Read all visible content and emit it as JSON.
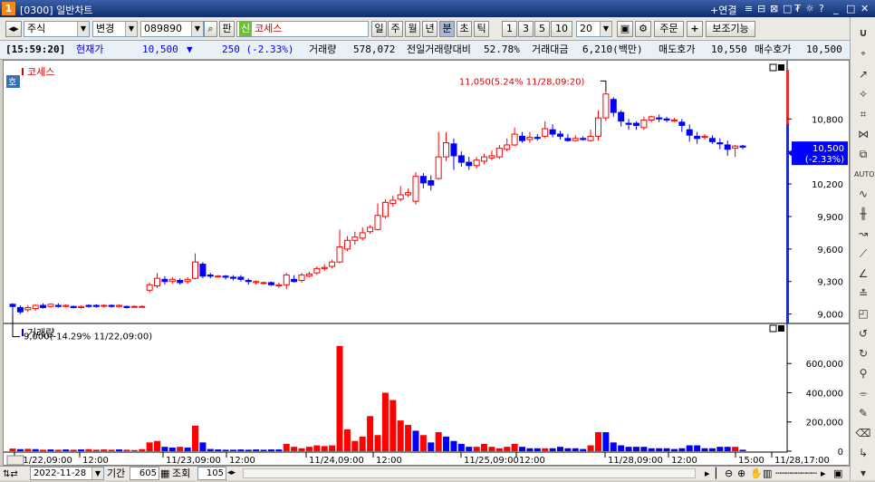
{
  "window": {
    "number": "1",
    "title": "[0300] 일반차트",
    "controls": [
      "+연결",
      "≡",
      "⊟",
      "⊠",
      "□",
      "₮",
      "☼",
      "?",
      "_",
      "□",
      "✕"
    ]
  },
  "toolbar": {
    "market_select": "주식",
    "change_select": "변경",
    "code_input": "089890",
    "pan_label": "판",
    "new_badge": "신",
    "stock_name": "코세스",
    "period_buttons": [
      "일",
      "주",
      "월",
      "년",
      "분",
      "초",
      "틱"
    ],
    "period_selected": "분",
    "interval_buttons": [
      "1",
      "3",
      "5",
      "10"
    ],
    "interval_value": "20",
    "order_button": "주문",
    "plus_label": "+",
    "aux_button": "보조기능"
  },
  "info": {
    "time": "[15:59:20]",
    "price_label": "현재가",
    "price": "10,500",
    "arrow": "▼",
    "change": "250 (-2.33%)",
    "volume_label": "거래량",
    "volume": "578,072",
    "prev_volume_label": "전일거래량대비",
    "prev_volume_ratio": "52.78%",
    "amount_label": "거래대금",
    "amount": "6,210(백만)",
    "ask_label": "매도호가",
    "ask": "10,550",
    "bid_label": "매수호가",
    "bid": "10,500"
  },
  "chart_data": [
    {
      "type": "candlestick",
      "title": "코세스",
      "side_badge": "호",
      "y_ticks": [
        "10,800",
        "10,500",
        "10,200",
        "9,900",
        "9,600",
        "9,300",
        "9,000"
      ],
      "ylim": [
        8930,
        11170
      ],
      "current_price_label": "10,500",
      "current_change_label": "(-2.33%)",
      "high_annotation": "11,050(5.24% 11/28,09:20)",
      "low_annotation": "9,000(-14.29% 11/22,09:00)",
      "candles": [
        [
          9090,
          9070,
          9100,
          9000
        ],
        [
          9060,
          9020,
          9080,
          9000
        ],
        [
          9040,
          9060,
          9080,
          9020
        ],
        [
          9050,
          9080,
          9090,
          9030
        ],
        [
          9080,
          9060,
          9100,
          9050
        ],
        [
          9070,
          9090,
          9100,
          9060
        ],
        [
          9080,
          9070,
          9100,
          9060
        ],
        [
          9070,
          9080,
          9090,
          9060
        ],
        [
          9070,
          9060,
          9080,
          9050
        ],
        [
          9060,
          9070,
          9080,
          9050
        ],
        [
          9080,
          9070,
          9090,
          9060
        ],
        [
          9080,
          9070,
          9090,
          9060
        ],
        [
          9080,
          9080,
          9090,
          9060
        ],
        [
          9080,
          9070,
          9090,
          9060
        ],
        [
          9070,
          9080,
          9090,
          9060
        ],
        [
          9070,
          9060,
          9080,
          9050
        ],
        [
          9070,
          9070,
          9080,
          9060
        ],
        [
          9070,
          9070,
          9080,
          9060
        ],
        [
          9220,
          9270,
          9290,
          9200
        ],
        [
          9260,
          9330,
          9380,
          9240
        ],
        [
          9320,
          9300,
          9350,
          9270
        ],
        [
          9300,
          9320,
          9340,
          9280
        ],
        [
          9310,
          9290,
          9330,
          9270
        ],
        [
          9300,
          9320,
          9340,
          9280
        ],
        [
          9330,
          9480,
          9560,
          9320
        ],
        [
          9460,
          9350,
          9480,
          9330
        ],
        [
          9360,
          9350,
          9380,
          9330
        ],
        [
          9350,
          9350,
          9360,
          9340
        ],
        [
          9350,
          9340,
          9360,
          9320
        ],
        [
          9340,
          9330,
          9360,
          9310
        ],
        [
          9340,
          9320,
          9360,
          9300
        ],
        [
          9310,
          9300,
          9330,
          9270
        ],
        [
          9290,
          9300,
          9310,
          9270
        ],
        [
          9290,
          9290,
          9300,
          9270
        ],
        [
          9290,
          9270,
          9300,
          9260
        ],
        [
          9260,
          9270,
          9290,
          9240
        ],
        [
          9270,
          9360,
          9380,
          9230
        ],
        [
          9320,
          9300,
          9360,
          9290
        ],
        [
          9310,
          9360,
          9380,
          9290
        ],
        [
          9350,
          9370,
          9390,
          9340
        ],
        [
          9380,
          9420,
          9440,
          9360
        ],
        [
          9420,
          9430,
          9460,
          9400
        ],
        [
          9440,
          9480,
          9500,
          9420
        ],
        [
          9480,
          9620,
          9780,
          9470
        ],
        [
          9600,
          9680,
          9720,
          9580
        ],
        [
          9680,
          9710,
          9760,
          9640
        ],
        [
          9700,
          9750,
          9800,
          9680
        ],
        [
          9760,
          9800,
          9820,
          9740
        ],
        [
          9780,
          9910,
          10020,
          9770
        ],
        [
          9900,
          10030,
          10060,
          9880
        ],
        [
          10020,
          10050,
          10090,
          9990
        ],
        [
          10060,
          10100,
          10180,
          10040
        ],
        [
          10100,
          10120,
          10160,
          10080
        ],
        [
          10040,
          10270,
          10310,
          10010
        ],
        [
          10270,
          10210,
          10300,
          10160
        ],
        [
          10230,
          10190,
          10280,
          10140
        ],
        [
          10250,
          10450,
          10680,
          10240
        ],
        [
          10450,
          10580,
          10680,
          10410
        ],
        [
          10570,
          10460,
          10620,
          10330
        ],
        [
          10460,
          10400,
          10500,
          10360
        ],
        [
          10400,
          10370,
          10450,
          10330
        ],
        [
          10370,
          10420,
          10450,
          10340
        ],
        [
          10410,
          10450,
          10480,
          10380
        ],
        [
          10440,
          10460,
          10510,
          10420
        ],
        [
          10450,
          10530,
          10560,
          10430
        ],
        [
          10520,
          10560,
          10620,
          10500
        ],
        [
          10560,
          10660,
          10720,
          10550
        ],
        [
          10640,
          10600,
          10680,
          10580
        ],
        [
          10610,
          10630,
          10680,
          10580
        ],
        [
          10630,
          10620,
          10660,
          10600
        ],
        [
          10640,
          10710,
          10780,
          10620
        ],
        [
          10700,
          10660,
          10750,
          10630
        ],
        [
          10660,
          10640,
          10690,
          10610
        ],
        [
          10620,
          10600,
          10660,
          10590
        ],
        [
          10600,
          10620,
          10650,
          10590
        ],
        [
          10620,
          10610,
          10640,
          10600
        ],
        [
          10600,
          10640,
          10700,
          10590
        ],
        [
          10640,
          10810,
          10880,
          10600
        ],
        [
          10810,
          11030,
          11050,
          10780
        ],
        [
          10980,
          10860,
          11000,
          10820
        ],
        [
          10860,
          10780,
          10880,
          10730
        ],
        [
          10760,
          10750,
          10800,
          10700
        ],
        [
          10760,
          10740,
          10780,
          10700
        ],
        [
          10720,
          10790,
          10820,
          10700
        ],
        [
          10790,
          10820,
          10830,
          10770
        ],
        [
          10810,
          10800,
          10840,
          10770
        ],
        [
          10800,
          10790,
          10820,
          10770
        ],
        [
          10780,
          10790,
          10810,
          10770
        ],
        [
          10770,
          10740,
          10800,
          10680
        ],
        [
          10700,
          10650,
          10750,
          10590
        ],
        [
          10640,
          10620,
          10680,
          10570
        ],
        [
          10630,
          10640,
          10660,
          10610
        ],
        [
          10620,
          10590,
          10650,
          10570
        ],
        [
          10580,
          10570,
          10620,
          10520
        ],
        [
          10560,
          10520,
          10600,
          10460
        ],
        [
          10530,
          10550,
          10560,
          10450
        ],
        [
          10550,
          10540,
          10560,
          10520
        ]
      ],
      "x_labels": [
        "11/22,09:00",
        "12:00",
        "11/23,09:00",
        "12:00",
        "11/24,09:00",
        "12:00",
        "11/25,09:00",
        "12:00",
        "11/28,09:00",
        "12:00",
        "15:00",
        "11/28,17:00"
      ]
    },
    {
      "type": "bar",
      "title": "거래량",
      "y_ticks": [
        "600,000",
        "400,000",
        "200,000",
        "0"
      ],
      "ylim": [
        0,
        750000
      ],
      "values": [
        [
          18000,
          1
        ],
        [
          14000,
          0
        ],
        [
          16000,
          1
        ],
        [
          14000,
          0
        ],
        [
          10000,
          1
        ],
        [
          12000,
          0
        ],
        [
          10000,
          1
        ],
        [
          12000,
          0
        ],
        [
          10000,
          1
        ],
        [
          12000,
          0
        ],
        [
          14000,
          1
        ],
        [
          10000,
          1
        ],
        [
          12000,
          1
        ],
        [
          10000,
          1
        ],
        [
          12000,
          0
        ],
        [
          10000,
          1
        ],
        [
          8000,
          1
        ],
        [
          14000,
          1
        ],
        [
          60000,
          1
        ],
        [
          70000,
          1
        ],
        [
          30000,
          0
        ],
        [
          25000,
          0
        ],
        [
          30000,
          1
        ],
        [
          25000,
          0
        ],
        [
          175000,
          1
        ],
        [
          60000,
          0
        ],
        [
          15000,
          0
        ],
        [
          12000,
          0
        ],
        [
          10000,
          0
        ],
        [
          10000,
          0
        ],
        [
          12000,
          0
        ],
        [
          10000,
          0
        ],
        [
          12000,
          0
        ],
        [
          10000,
          0
        ],
        [
          12000,
          0
        ],
        [
          12000,
          0
        ],
        [
          50000,
          1
        ],
        [
          30000,
          1
        ],
        [
          20000,
          1
        ],
        [
          30000,
          1
        ],
        [
          40000,
          1
        ],
        [
          35000,
          1
        ],
        [
          40000,
          1
        ],
        [
          720000,
          1
        ],
        [
          150000,
          1
        ],
        [
          70000,
          1
        ],
        [
          100000,
          1
        ],
        [
          240000,
          1
        ],
        [
          110000,
          1
        ],
        [
          400000,
          1
        ],
        [
          350000,
          1
        ],
        [
          210000,
          1
        ],
        [
          180000,
          1
        ],
        [
          140000,
          0
        ],
        [
          110000,
          1
        ],
        [
          60000,
          0
        ],
        [
          130000,
          1
        ],
        [
          100000,
          0
        ],
        [
          70000,
          0
        ],
        [
          50000,
          0
        ],
        [
          30000,
          0
        ],
        [
          30000,
          1
        ],
        [
          50000,
          1
        ],
        [
          30000,
          1
        ],
        [
          20000,
          1
        ],
        [
          30000,
          1
        ],
        [
          50000,
          1
        ],
        [
          30000,
          0
        ],
        [
          20000,
          0
        ],
        [
          20000,
          0
        ],
        [
          20000,
          1
        ],
        [
          20000,
          0
        ],
        [
          30000,
          0
        ],
        [
          20000,
          0
        ],
        [
          20000,
          0
        ],
        [
          15000,
          0
        ],
        [
          40000,
          1
        ],
        [
          130000,
          1
        ],
        [
          130000,
          0
        ],
        [
          60000,
          0
        ],
        [
          40000,
          0
        ],
        [
          30000,
          0
        ],
        [
          30000,
          0
        ],
        [
          30000,
          0
        ],
        [
          20000,
          0
        ],
        [
          20000,
          0
        ],
        [
          20000,
          0
        ],
        [
          15000,
          0
        ],
        [
          20000,
          0
        ],
        [
          40000,
          0
        ],
        [
          40000,
          0
        ],
        [
          20000,
          0
        ],
        [
          20000,
          0
        ],
        [
          30000,
          0
        ],
        [
          30000,
          0
        ],
        [
          30000,
          1
        ],
        [
          10000,
          0
        ]
      ]
    }
  ],
  "bottombar": {
    "date": "2022-11-28",
    "period_label": "기간",
    "period_value": "605",
    "query_label": "조회",
    "query_value": "105"
  },
  "colors": {
    "up": "#ff0000",
    "down": "#0000ff",
    "price_box": "#0000ff"
  }
}
